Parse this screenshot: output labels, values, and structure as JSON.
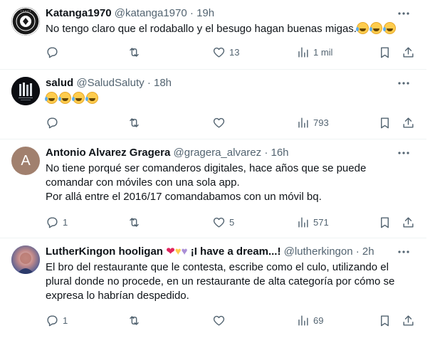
{
  "tweets": [
    {
      "name": "Katanga1970",
      "handle": "@katanga1970",
      "dot": "·",
      "time": "19h",
      "text": "No tengo claro que el rodaballo y el besugo hagan buenas migas.",
      "emoji_count": 3,
      "avatar": "circular-badge-logo",
      "actions": {
        "reply": "",
        "retweet": "",
        "like": "13",
        "views": "1 mil"
      }
    },
    {
      "name": "salud",
      "handle": "@SaludSaluty",
      "dot": "·",
      "time": "18h",
      "text": "",
      "emoji_count": 4,
      "avatar": "dark-building-image",
      "actions": {
        "reply": "",
        "retweet": "",
        "like": "",
        "views": "793"
      }
    },
    {
      "name": "Antonio Alvarez Gragera",
      "handle": "@gragera_alvarez",
      "dot": "·",
      "time": "16h",
      "lines": [
        "No tiene porqué ser comanderos digitales, hace años que se puede",
        "comandar con móviles con una sola app.",
        "Por allá entre el 2016/17 comandabamos con un móvil bq."
      ],
      "avatar_letter": "A",
      "avatar_color": "#a1806e",
      "actions": {
        "reply": "1",
        "retweet": "",
        "like": "5",
        "views": "571"
      }
    },
    {
      "name": "LutherKingon hooligan",
      "name_suffix": "¡I have a dream...!",
      "handle": "@lutherkingon",
      "dot": "·",
      "time": "2h",
      "hearts": [
        "❤",
        "💛",
        "💜"
      ],
      "lines": [
        "El bro del restaurante que le contesta, escribe como el culo, utilizando el",
        "plural donde no procede, en un restaurante de alta categoría por cómo se",
        "expresa lo habrían despedido."
      ],
      "avatar": "dream-portrait",
      "actions": {
        "reply": "1",
        "retweet": "",
        "like": "",
        "views": "69"
      }
    }
  ],
  "icons": {
    "reply": "reply-icon",
    "retweet": "retweet-icon",
    "like": "heart-icon",
    "views": "views-icon",
    "bookmark": "bookmark-icon",
    "share": "share-icon",
    "more": "more-icon"
  }
}
